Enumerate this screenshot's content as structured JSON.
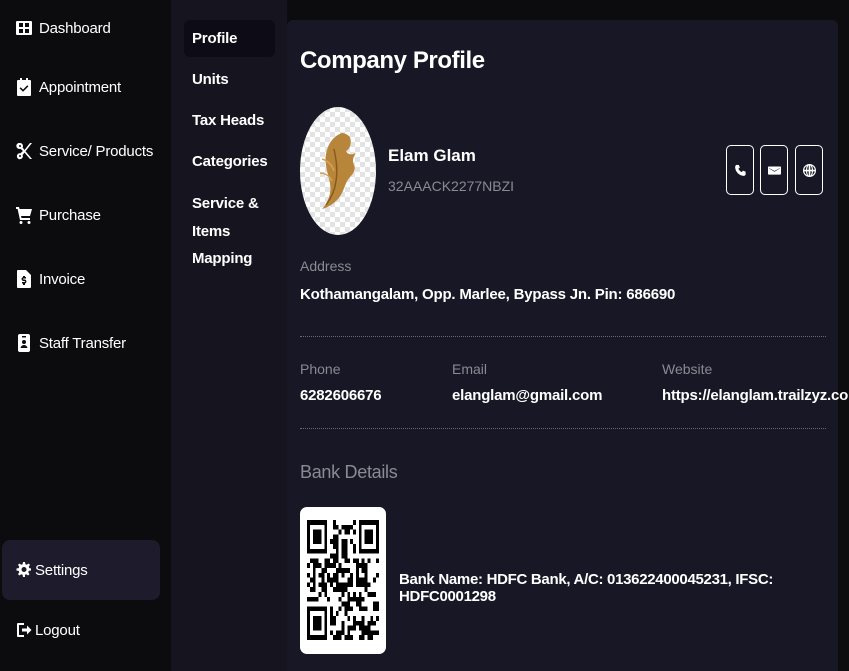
{
  "sidebar": {
    "items": [
      {
        "label": "Dashboard",
        "icon": "dashboard-icon"
      },
      {
        "label": "Appointment",
        "icon": "calendar-check-icon"
      },
      {
        "label": "Service/ Products",
        "icon": "scissors-icon"
      },
      {
        "label": "Purchase",
        "icon": "cart-icon"
      },
      {
        "label": "Invoice",
        "icon": "invoice-icon"
      },
      {
        "label": "Staff Transfer",
        "icon": "staff-transfer-icon"
      }
    ],
    "settings_label": "Settings",
    "logout_label": "Logout"
  },
  "settings_menu": {
    "items": [
      "Profile",
      "Units",
      "Tax Heads",
      "Categories",
      "Service &",
      "Items",
      "Mapping"
    ],
    "active": "Profile"
  },
  "profile": {
    "title": "Company Profile",
    "company_name": "Elam Glam",
    "gstin": "32AAACK2277NBZI",
    "address_label": "Address",
    "address": "Kothamangalam, Opp. Marlee, Bypass Jn. Pin: 686690",
    "phone_label": "Phone",
    "phone": "6282606676",
    "email_label": "Email",
    "email": "elanglam@gmail.com",
    "website_label": "Website",
    "website": "https://elanglam.trailzyz.com",
    "bank_title": "Bank Details",
    "bank_info": "Bank Name: HDFC Bank, A/C: 013622400045231, IFSC: HDFC0001298"
  },
  "colors": {
    "sidebar_bg": "#0c0c0e",
    "submenu_bg": "#16151f",
    "card_bg": "#181726",
    "active_bg": "#1d1b2c",
    "muted_text": "#8a8a92"
  }
}
